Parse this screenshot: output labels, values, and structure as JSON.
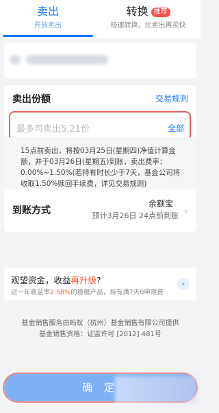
{
  "tabs": [
    {
      "title": "卖出",
      "subtitle": "开放卖出"
    },
    {
      "title": "转换",
      "badge": "推荐",
      "subtitle": "极速转换，比卖出再买快"
    }
  ],
  "sell_amount": {
    "title": "卖出份额",
    "rules_link": "交易规则",
    "placeholder": "最多可卖出5.21份",
    "all_button": "全部"
  },
  "note": "15点前卖出，将按03月25日(星期四)净值计算金额，并于03月26日(星期五)到账，卖出费率：0.00%~1.50%(若持有时长少于7天，基金公司将收取1.50%赎回手续费，详见交易规则)",
  "arrival": {
    "title": "到账方式",
    "destination": "余额宝",
    "estimate": "预计3月26日 24点前到账"
  },
  "promo": {
    "title_prefix": "观望资金，收益",
    "title_highlight": "再升级",
    "title_suffix": "?",
    "desc_prefix": "近一年收益率",
    "desc_rate": "2.58%",
    "desc_suffix": "的稳健产品，持有满7天0申赎费"
  },
  "footer": {
    "line1": "基金销售服务由蚂蚁（杭州）基金销售有限公司提供",
    "line2": "基金销售资格：证监许可 [2012] 481号"
  },
  "confirm_button": "确 定",
  "colors": {
    "accent": "#1677ff",
    "highlight": "#ff5a2c",
    "badge": "#ff4d4f"
  }
}
